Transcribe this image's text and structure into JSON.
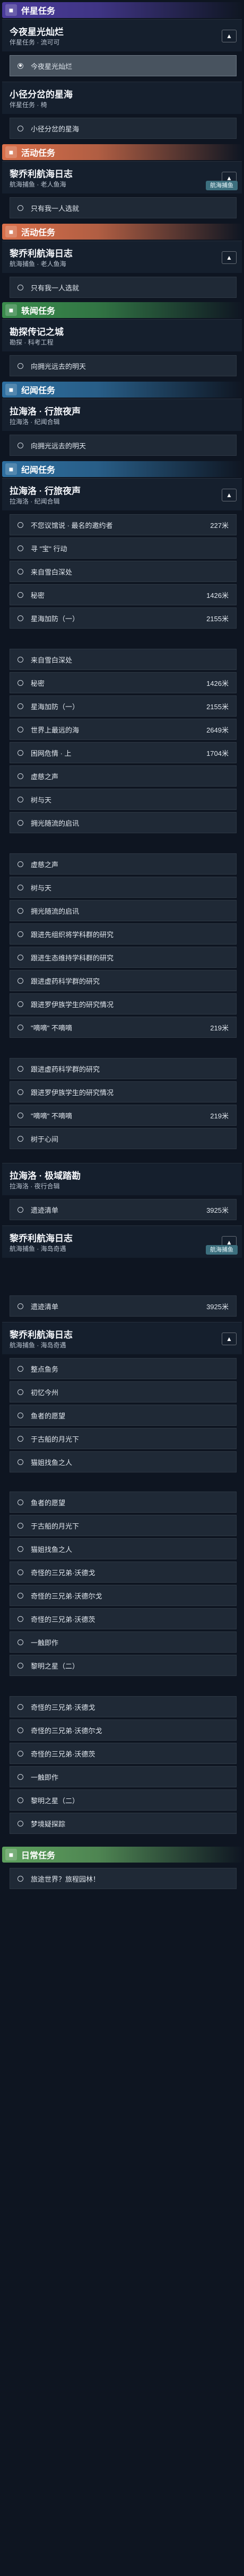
{
  "colors": {
    "companion": "#4b3c9c",
    "event": "#d9704b",
    "anecdote": "#3a8c4c",
    "travel": "#2e6fa0",
    "daily": "#5ea15e"
  },
  "icons": {
    "companion": "companion-icon",
    "event": "event-icon",
    "anecdote": "anecdote-icon",
    "travel": "travel-icon",
    "daily": "daily-icon"
  },
  "categories": {
    "companion": "伴星任务",
    "event": "活动任务",
    "anecdote": "轶闻任务",
    "travel": "纪闻任务",
    "daily": "日常任务"
  },
  "quests": {
    "q1": {
      "title": "今夜星光灿烂",
      "subtitle": "伴星任务 · 流可可"
    },
    "q2": {
      "title": "小径分岔的星海",
      "subtitle": "伴星任务 · 椅"
    },
    "q3": {
      "title": "黎乔利航海日志",
      "subtitle": "航海捕鱼 · 老人鱼海",
      "chip": "航海捕鱼"
    },
    "q4": {
      "title": "黎乔利航海日志",
      "subtitle": "航海捕鱼 · 老人鱼海"
    },
    "q5": {
      "title": "勘探传记之城",
      "subtitle": "勘探 · 科考工程"
    },
    "q6": {
      "title": "拉海洛 · 行旅夜声",
      "subtitle": "拉海洛 · 纪闻合辑"
    },
    "q7": {
      "title": "拉海洛 · 行旅夜声",
      "subtitle": "拉海洛 · 纪闻合辑"
    },
    "q8": {
      "title": "拉海洛 · 极域踏勘",
      "subtitle": "拉海洛 · 夜行合辑"
    },
    "q9": {
      "title": "黎乔利航海日志",
      "subtitle": "航海捕鱼 · 海岛奇遇",
      "chip": "航海捕鱼"
    },
    "q10": {
      "title": "黎乔利航海日志",
      "subtitle": "航海捕鱼 · 海岛奇遇"
    },
    "q11": {
      "title": "旅途世界？旅程园林！"
    }
  },
  "steps": {
    "s1": "今夜星光灿烂",
    "s2": "小径分岔的星海",
    "s3": "只有我一人选就",
    "s4": "只有我一人选就",
    "s5": "向拥光远去的明天",
    "s6": "向拥光远去的明天",
    "a1": "不您议馆说 · 最名的邀约者",
    "a1d": "227米",
    "a2": "寻 \"宝\" 行动",
    "a3": "来自雪白深处",
    "a4": "秘密",
    "a4d": "1426米",
    "a5": "星海加防（一）",
    "a5d": "2155米",
    "b1": "来自雪白深处",
    "b2": "秘密",
    "b2d": "1426米",
    "b3": "星海加防（一）",
    "b3d": "2155米",
    "b4": "世界上最远的海",
    "b4d": "2649米",
    "b5": "困网危情 · 上",
    "b5d": "1704米",
    "b6": "虚慈之声",
    "b7": "树与天",
    "b8": "拥光随流的启讯",
    "c1": "虚慈之声",
    "c2": "树与天",
    "c3": "拥光随流的启讯",
    "c4": "跟进先组织将学科群的研究",
    "c5": "跟进生态维持学科群的研究",
    "c6": "跟进虚药科学群的研究",
    "c7": "跟进罗伊族学生的研究情况",
    "c8": "\"嘀嘀\" 不嘀嘀",
    "c8d": "219米",
    "d1": "跟进虚药科学群的研究",
    "d2": "跟进罗伊族学生的研究情况",
    "d3": "\"嘀嘀\" 不嘀嘀",
    "d3d": "219米",
    "d4": "树于心间",
    "e1": "遗迹清单",
    "e1d": "3925米",
    "f1": "遗迹清单",
    "f1d": "3925米",
    "g1": "整点鱼务",
    "g2": "初忆今州",
    "g3": "鱼者的愿望",
    "g4": "于古船的月光下",
    "g5": "猫姐找鱼之人",
    "h1": "鱼者的愿望",
    "h2": "于古船的月光下",
    "h3": "猫姐找鱼之人",
    "h4": "奇怪的三兄弟·沃德戈",
    "h5": "奇怪的三兄弟·沃德尔戈",
    "h6": "奇怪的三兄弟·沃德茨",
    "h7": "一触即作",
    "h8": "黎明之星（二）",
    "i1": "奇怪的三兄弟·沃德戈",
    "i2": "奇怪的三兄弟·沃德尔戈",
    "i3": "奇怪的三兄弟·沃德茨",
    "i4": "一触即作",
    "i5": "黎明之星（二）",
    "i6": "梦境疑探踪",
    "j1": "旅途世界？旅程园林！"
  }
}
